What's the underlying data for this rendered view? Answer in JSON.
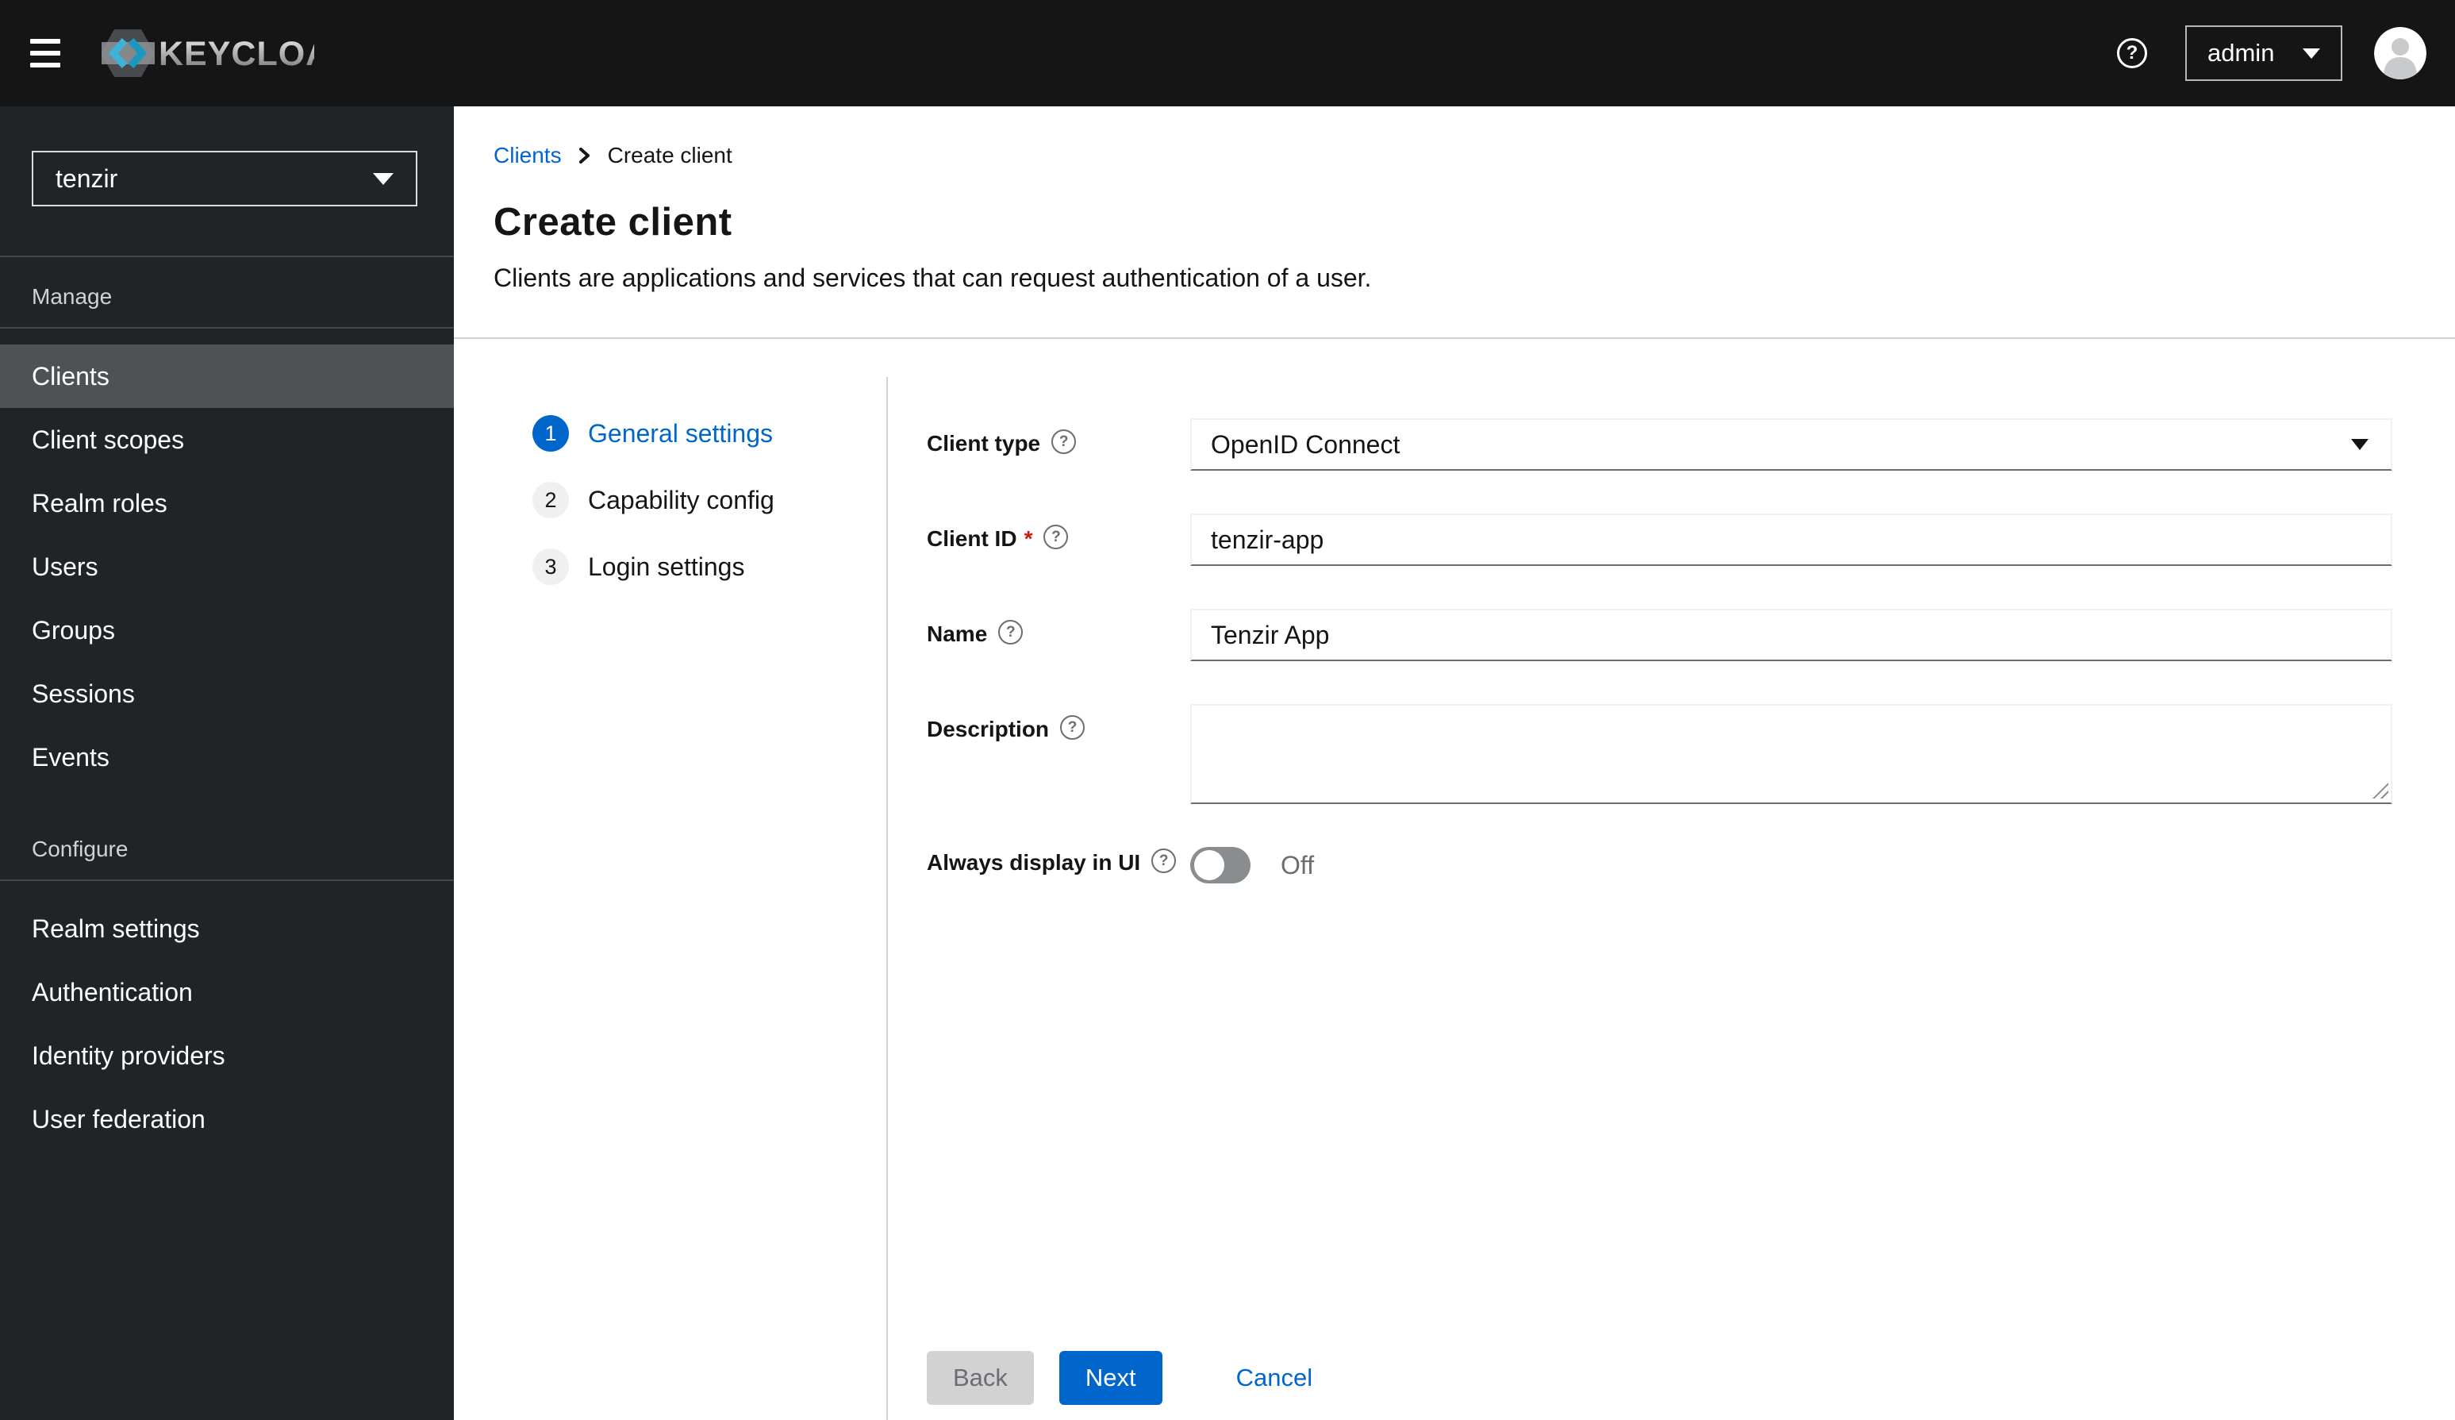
{
  "masthead": {
    "brand_text": "KEYCLOAK",
    "user_menu": {
      "label": "admin"
    }
  },
  "icons": {
    "help_glyph": "?"
  },
  "sidebar": {
    "realm_selector": {
      "value": "tenzir"
    },
    "manage": {
      "title": "Manage",
      "items": [
        {
          "label": "Clients"
        },
        {
          "label": "Client scopes"
        },
        {
          "label": "Realm roles"
        },
        {
          "label": "Users"
        },
        {
          "label": "Groups"
        },
        {
          "label": "Sessions"
        },
        {
          "label": "Events"
        }
      ]
    },
    "configure": {
      "title": "Configure",
      "items": [
        {
          "label": "Realm settings"
        },
        {
          "label": "Authentication"
        },
        {
          "label": "Identity providers"
        },
        {
          "label": "User federation"
        }
      ]
    }
  },
  "breadcrumb": {
    "parent": "Clients",
    "current": "Create client"
  },
  "header": {
    "title": "Create client",
    "subtitle": "Clients are applications and services that can request authentication of a user."
  },
  "wizard": {
    "steps": [
      {
        "number": "1",
        "label": "General settings"
      },
      {
        "number": "2",
        "label": "Capability config"
      },
      {
        "number": "3",
        "label": "Login settings"
      }
    ]
  },
  "form": {
    "client_type": {
      "label": "Client type",
      "value": "OpenID Connect"
    },
    "client_id": {
      "label": "Client ID",
      "required_indicator": "*",
      "value": "tenzir-app"
    },
    "name": {
      "label": "Name",
      "value": "Tenzir App"
    },
    "description": {
      "label": "Description",
      "value": ""
    },
    "always_display": {
      "label": "Always display in UI",
      "state_label": "Off"
    }
  },
  "footer": {
    "back": "Back",
    "next": "Next",
    "cancel": "Cancel"
  },
  "colors": {
    "primary_blue": "#0066cc",
    "masthead_bg": "#151515",
    "sidebar_bg": "#212427",
    "sidebar_current_bg": "#4f5255",
    "required_red": "#c9190b",
    "divider_gray": "#d2d2d2",
    "muted_gray": "#6a6e73"
  }
}
